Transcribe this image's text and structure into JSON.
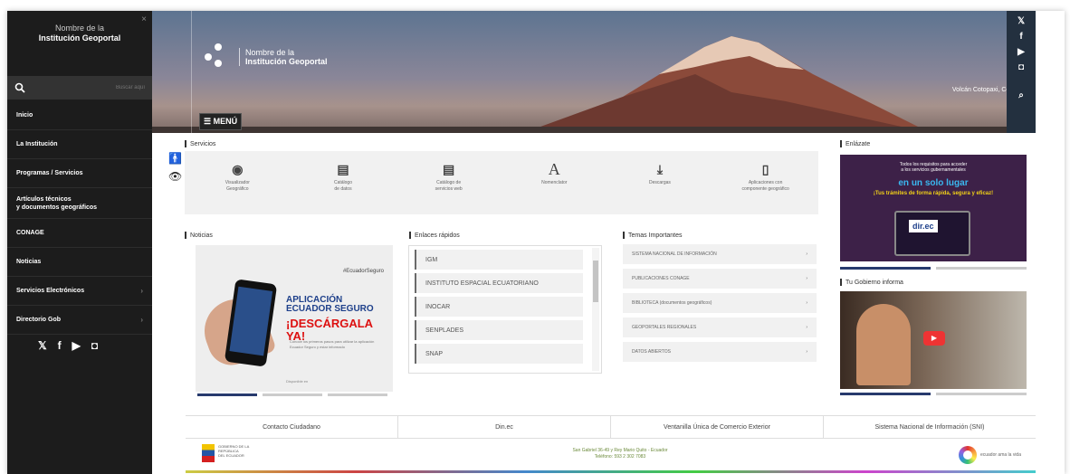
{
  "sidebar": {
    "close": "×",
    "logo_line1": "Nombre de la",
    "logo_line2": "Institución Geoportal",
    "search_placeholder": "Buscar aquí",
    "items": [
      {
        "label": "Inicio",
        "chevron": ""
      },
      {
        "label": "La Institución",
        "chevron": ""
      },
      {
        "label": "Programas / Servicios",
        "chevron": ""
      },
      {
        "label": "Artículos técnicos\ny documentos geográficos",
        "chevron": ""
      },
      {
        "label": "CONAGE",
        "chevron": ""
      },
      {
        "label": "Noticias",
        "chevron": ""
      },
      {
        "label": "Servicios Electrónicos",
        "chevron": "›"
      },
      {
        "label": "Directorio Gob",
        "chevron": "›"
      }
    ],
    "social": [
      "𝕏",
      "f",
      "▶",
      "◘"
    ]
  },
  "hero": {
    "logo_line1": "Nombre de la",
    "logo_line2": "Institución Geoportal",
    "menu_label": "☰ MENÚ",
    "caption": "Volcán Cotopaxi, Cotopaxi"
  },
  "right_bar": [
    "𝕏",
    "f",
    "▶",
    "◘",
    "⌕"
  ],
  "accessibility": [
    "🚹",
    "👁"
  ],
  "services": {
    "title": "Servicios",
    "items": [
      {
        "icon": "◉",
        "label": "Visualizador\nGeográfico"
      },
      {
        "icon": "▤",
        "label": "Catálogo\nde datos"
      },
      {
        "icon": "▤",
        "label": "Catálogo de\nservicios web"
      },
      {
        "icon": "A",
        "label": "Nomenclator"
      },
      {
        "icon": "⤓",
        "label": "Descargas"
      },
      {
        "icon": "▯",
        "label": "Aplicaciones con\ncomponente geográfico"
      }
    ]
  },
  "news": {
    "title": "Noticias",
    "brand": "#EcuadorSeguro",
    "app_title": "APLICACIÓN\nECUADOR SEGURO",
    "app_cta": "¡DESCÁRGALA YA!",
    "app_lines": "Conoce los primeros pasos para utilizar la aplicación\nEcuador Seguro y estar informado",
    "footer": "Disponible en"
  },
  "quick_links": {
    "title": "Enlaces rápidos",
    "items": [
      "IGM",
      "INSTITUTO ESPACIAL ECUATORIANO",
      "INOCAR",
      "SENPLADES",
      "SNAP"
    ]
  },
  "temas": {
    "title": "Temas Importantes",
    "items": [
      "SISTEMA NACIONAL DE INFORMACIÓN",
      "PUBLICACIONES CONAGE",
      "BIBLIOTECA (documentos geográficos)",
      "GEOPORTALES REGIONALES",
      "DATOS ABIERTOS"
    ]
  },
  "enlazate": {
    "title": "Enlázate",
    "text1": "Todos los requisitos para acceder\na los servicios gubernamentales",
    "text2": "en un solo lugar",
    "text3": "¡Tus trámites de forma rápida, segura y eficaz!",
    "logo": "dir.ec"
  },
  "gobierno": {
    "title": "Tu Gobierno informa",
    "play": "▶"
  },
  "footer_links": [
    "Contacto Ciudadano",
    "Din.ec",
    "Ventanilla Única de Comercio Exterior",
    "Sistema Nacional de Información (SNI)"
  ],
  "footer": {
    "gov_text": "GOBIERNO DE LA REPÚBLICA\nDEL ECUADOR",
    "address": "San Gabriel 36-49 y Rey Mario Quito - Ecuador\nTeléfono: 593 2 302 7083",
    "brand": "ecuador ama la vida"
  }
}
